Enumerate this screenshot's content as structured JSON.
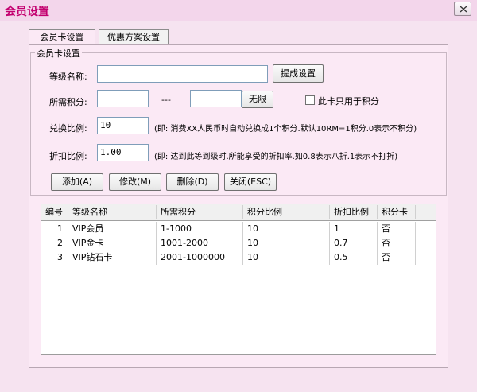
{
  "window": {
    "title": "会员设置"
  },
  "tabs": [
    {
      "label": "会员卡设置",
      "active": true
    },
    {
      "label": "优惠方案设置",
      "active": false
    }
  ],
  "group_label": "会员卡设置",
  "form": {
    "level_name_label": "等级名称:",
    "level_name_value": "",
    "preset_button": "提成设置",
    "points_label": "所需积分:",
    "points_from": "",
    "points_separator": "---",
    "points_to": "",
    "unlimited_button": "无限",
    "card_points_only_label": "此卡只用于积分",
    "ratio_label": "兑换比例:",
    "ratio_value": "10",
    "ratio_hint": "(即: 消费XX人民币时自动兑换成1个积分.默认10RM=1积分.0表示不积分)",
    "discount_label": "折扣比例:",
    "discount_value": "1.00",
    "discount_hint": "(即: 达到此等到级时.所能享受的折扣率.如0.8表示八折.1表示不打折)"
  },
  "actions": {
    "add": "添加(A)",
    "edit": "修改(M)",
    "delete": "删除(D)",
    "close": "关闭(ESC)"
  },
  "table": {
    "columns": [
      "编号",
      "等级名称",
      "所需积分",
      "积分比例",
      "折扣比例",
      "积分卡"
    ],
    "rows": [
      [
        "1",
        "VIP会员",
        "1-1000",
        "10",
        "1",
        "否"
      ],
      [
        "2",
        "VIP金卡",
        "1001-2000",
        "10",
        "0.7",
        "否"
      ],
      [
        "3",
        "VIP钻石卡",
        "2001-1000000",
        "10",
        "0.5",
        "否"
      ]
    ]
  }
}
